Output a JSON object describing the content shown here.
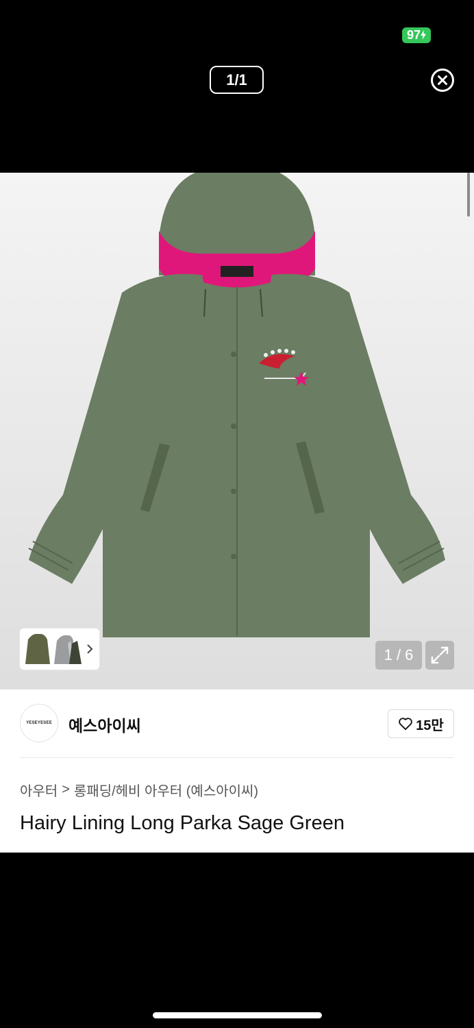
{
  "status_bar": {
    "battery": "97"
  },
  "viewer": {
    "counter": "1/1"
  },
  "product": {
    "image_counter": "1 / 6",
    "brand_logo_text": "YESEYESEE",
    "brand_name": "예스아이씨",
    "likes": "15만",
    "breadcrumb": {
      "category": "아우터",
      "separator": ">",
      "subcategory": "롱패딩/헤비 아우터 (예스아이씨)"
    },
    "title": "Hairy Lining Long Parka Sage Green"
  },
  "icons": {
    "close": "close-circle-icon",
    "expand": "expand-icon",
    "heart": "heart-outline-icon",
    "chevron": "chevron-right-icon",
    "charging": "bolt-icon"
  },
  "colors": {
    "jacket": "#6b7d62",
    "lining": "#e0177a",
    "battery": "#34c759"
  }
}
